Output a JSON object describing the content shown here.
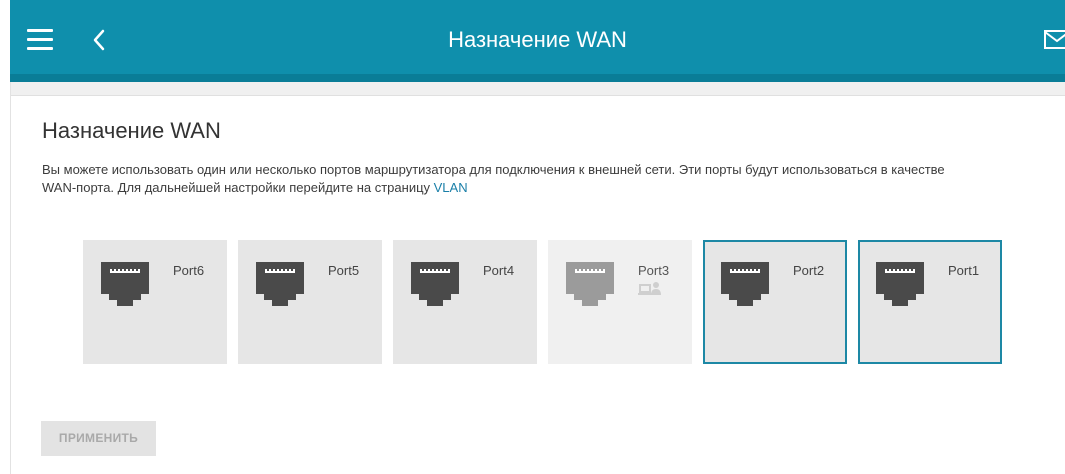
{
  "header": {
    "title": "Назначение WAN",
    "accent_color": "#0f8fac"
  },
  "main": {
    "title": "Назначение WAN",
    "description": "Вы можете использовать один или несколько портов маршрутизатора для подключения к внешней сети. Эти порты будут использоваться в качестве WAN-порта. Для дальнейшей настройки перейдите на страницу ",
    "link_text": "VLAN",
    "link_color": "#1a7fa8"
  },
  "ports": [
    {
      "label": "Port6",
      "selected": false,
      "disabled": false
    },
    {
      "label": "Port5",
      "selected": false,
      "disabled": false
    },
    {
      "label": "Port4",
      "selected": false,
      "disabled": false
    },
    {
      "label": "Port3",
      "selected": false,
      "disabled": true,
      "icon": "device-icon"
    },
    {
      "label": "Port2",
      "selected": true,
      "disabled": false
    },
    {
      "label": "Port1",
      "selected": true,
      "disabled": false
    }
  ],
  "actions": {
    "apply_label": "ПРИМЕНИТЬ",
    "apply_enabled": false
  }
}
